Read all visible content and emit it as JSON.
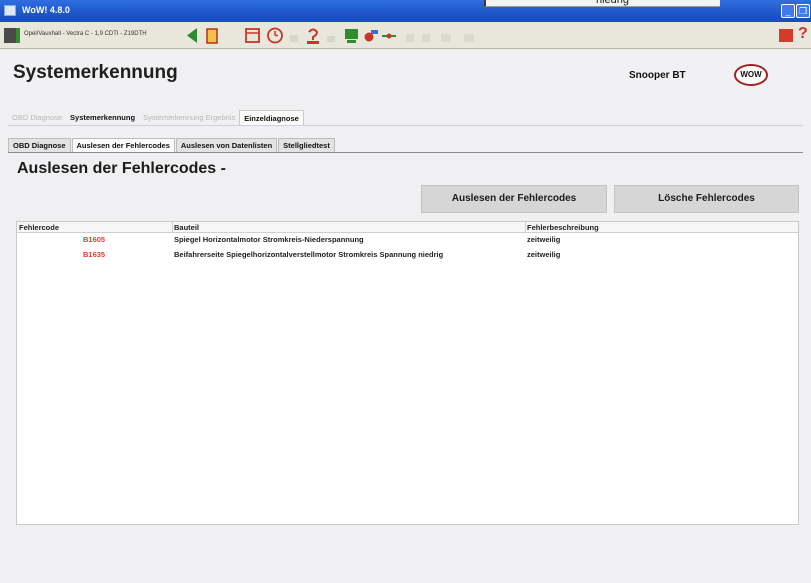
{
  "overlay": {
    "text": "niedrig"
  },
  "window": {
    "title": "WoW! 4.8.0",
    "minimize_glyph": "_",
    "restore_glyph": "❐"
  },
  "toolbar": {
    "vehicle": "Opel/Vauxhall - Vectra C - 1,9 CDTI - Z19DTH",
    "help_glyph": "?"
  },
  "header": {
    "title": "Systemerkennung",
    "device": "Snooper BT",
    "logo_text": "WOW"
  },
  "tabs_top": [
    "OBD Diagnose",
    "Systemerkennung",
    "Systemerkennung Ergebnis",
    "Einzeldiagnose"
  ],
  "tabs_sub": [
    "OBD Diagnose",
    "Auslesen der Fehlercodes",
    "Auslesen von Datenlisten",
    "Stellgliedtest"
  ],
  "page": {
    "heading": "Auslesen der Fehlercodes -"
  },
  "buttons": {
    "read": "Auslesen der Fehlercodes",
    "clear": "Lösche Fehlercodes"
  },
  "table": {
    "columns": [
      "Fehlercode",
      "Bauteil",
      "Fehlerbeschreibung"
    ],
    "rows": [
      {
        "code": "B1605",
        "component": "Spiegel Horizontalmotor Stromkreis-Niederspannung",
        "description": "zeitweilig"
      },
      {
        "code": "B1635",
        "component": "Beifahrerseite Spiegelhorizontalverstellmotor Stromkreis Spannung niedrig",
        "description": "zeitweilig"
      }
    ]
  },
  "colors": {
    "titlebar": "#2559d0",
    "error_code": "#e23a2b",
    "logo_ring": "#a21f1f"
  }
}
